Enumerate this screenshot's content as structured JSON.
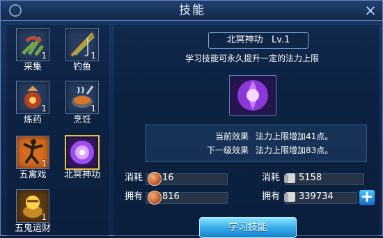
{
  "window": {
    "title": "技能",
    "close_icon": "close-icon"
  },
  "skills": [
    {
      "name": "采集",
      "level": "1",
      "icon": "herb-gathering-icon"
    },
    {
      "name": "钓鱼",
      "level": "1",
      "icon": "fishing-rod-icon"
    },
    {
      "name": "炼药",
      "level": "1",
      "icon": "alchemy-icon"
    },
    {
      "name": "烹饪",
      "level": "1",
      "icon": "cooking-pot-icon"
    },
    {
      "name": "五禽戏",
      "level": "1",
      "icon": "dancer-icon"
    },
    {
      "name": "北冥神功",
      "level": "",
      "icon": "purple-flower-icon"
    },
    {
      "name": "五鬼运财",
      "level": "1",
      "icon": "treasure-icon"
    }
  ],
  "detail": {
    "name": "北冥神功",
    "level": "Lv.1",
    "description": "学习技能可永久提升一定的法力上限",
    "current_label": "当前效果",
    "current_effect": "法力上限增加41点。",
    "next_label": "下一级效果",
    "next_effect": "法力上限增加83点。"
  },
  "resources": {
    "cost_label": "消耗",
    "own_label": "拥有",
    "coin_cost": "16",
    "coin_own": "816",
    "scroll_cost": "5158",
    "scroll_own": "339734"
  },
  "actions": {
    "learn_label": "学习技能"
  },
  "colors": {
    "accent_gold": "#e7c54b",
    "button_blue": "#39aeea",
    "panel": "#122b52"
  }
}
